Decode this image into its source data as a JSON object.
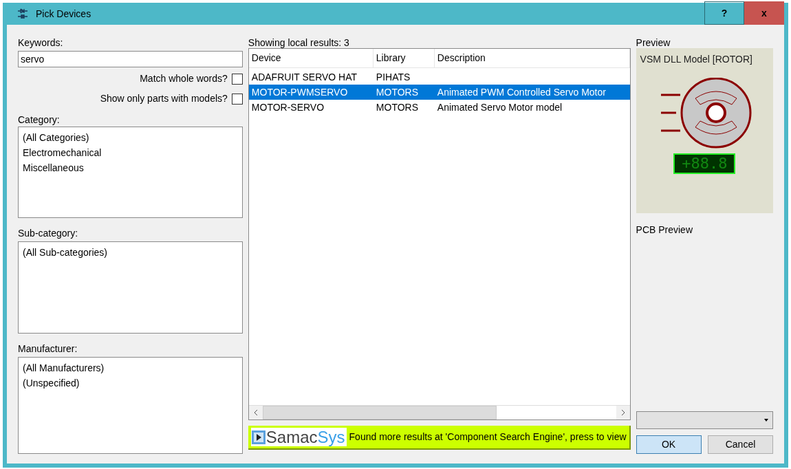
{
  "window": {
    "title": "Pick Devices",
    "buttons": [
      "?",
      "x"
    ]
  },
  "keywords": {
    "label": "Keywords:",
    "value": "servo"
  },
  "options": [
    {
      "label": "Match whole words?",
      "checked": false
    },
    {
      "label": "Show only parts with models?",
      "checked": false
    }
  ],
  "category": {
    "label": "Category:",
    "items": [
      {
        "label": "(All Categories)",
        "selected": false
      },
      {
        "label": "Electromechanical",
        "selected": false
      },
      {
        "label": "Miscellaneous",
        "selected": false
      }
    ]
  },
  "sub_category": {
    "label": "Sub-category:",
    "items": [
      {
        "label": "(All Sub-categories)",
        "selected": false
      }
    ]
  },
  "manufacturer": {
    "label": "Manufacturer:",
    "items": [
      {
        "label": "(All Manufacturers)",
        "selected": false
      },
      {
        "label": "(Unspecified)",
        "selected": false
      }
    ]
  },
  "results": {
    "label": "Showing local results: 3",
    "columns": [
      "Device",
      "Library",
      "Description"
    ],
    "rows": [
      {
        "cells": [
          "ADAFRUIT SERVO HAT",
          "PIHATS",
          ""
        ],
        "selected": false
      },
      {
        "cells": [
          "MOTOR-PWMSERVO",
          "MOTORS",
          "Animated PWM Controlled Servo Motor"
        ],
        "selected": true
      },
      {
        "cells": [
          "MOTOR-SERVO",
          "MOTORS",
          "Animated Servo Motor model"
        ],
        "selected": false
      }
    ]
  },
  "banner": {
    "logo_text": "Samac",
    "logo_accent": "Sys",
    "text": "Found more results at 'Component Search Engine', press to view"
  },
  "preview": {
    "label": "Preview",
    "model": "VSM DLL Model [ROTOR]",
    "display": "+88.8"
  },
  "pcb_preview": {
    "label": "PCB Preview"
  },
  "buttons": [
    "OK",
    "Cancel"
  ]
}
